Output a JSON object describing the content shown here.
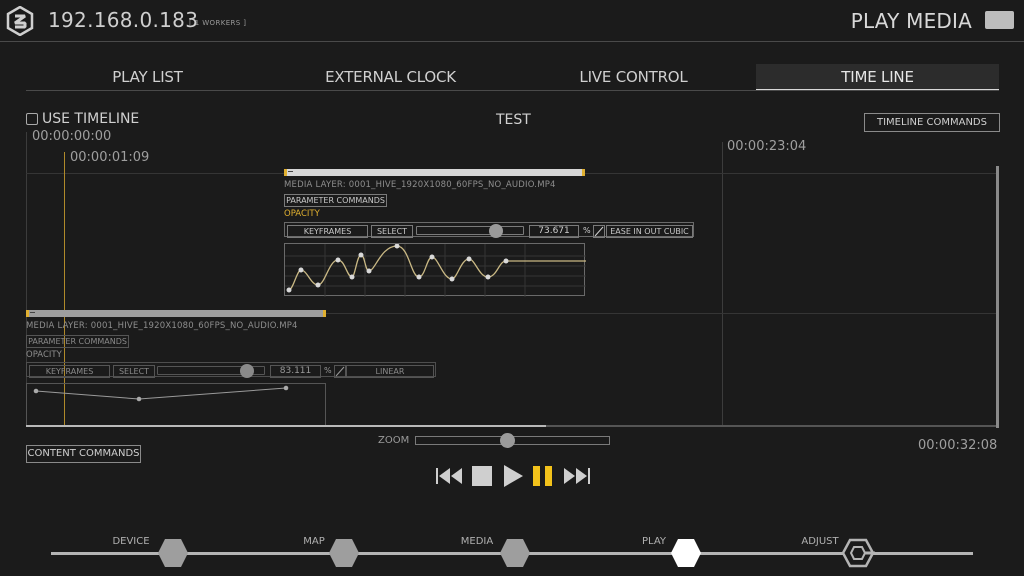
{
  "header": {
    "ip": "192.168.0.183",
    "workers": "[ 1 WORKERS ]",
    "page_title": "PLAY MEDIA"
  },
  "tabs": [
    {
      "label": "PLAY LIST",
      "active": false
    },
    {
      "label": "EXTERNAL CLOCK",
      "active": false
    },
    {
      "label": "LIVE CONTROL",
      "active": false
    },
    {
      "label": "TIME LINE",
      "active": true
    }
  ],
  "timeline": {
    "use_timeline_label": "USE TIMELINE",
    "use_timeline_checked": false,
    "name": "TEST",
    "commands_label": "TIMELINE COMMANDS",
    "time_start": "00:00:00:00",
    "time_cursor": "00:00:01:09",
    "time_mid": "00:00:23:04",
    "time_end": "00:00:32:08"
  },
  "layer_top": {
    "media_label": "MEDIA LAYER: 0001_HIVE_1920X1080_60FPS_NO_AUDIO.MP4",
    "param_commands": "PARAMETER COMMANDS",
    "opacity_label": "OPACITY",
    "keyframes": "KEYFRAMES",
    "select": "SELECT",
    "slider_fraction": 0.73671,
    "value": "73.671",
    "percent": "%",
    "easing": "EASE IN OUT CUBIC"
  },
  "layer_bottom": {
    "media_label": "MEDIA LAYER: 0001_HIVE_1920X1080_60FPS_NO_AUDIO.MP4",
    "param_commands": "PARAMETER COMMANDS",
    "opacity_label": "OPACITY",
    "keyframes": "KEYFRAMES",
    "select": "SELECT",
    "slider_fraction": 0.83111,
    "value": "83.111",
    "percent": "%",
    "easing": "LINEAR"
  },
  "controls": {
    "zoom_label": "ZOOM",
    "content_commands": "CONTENT COMMANDS"
  },
  "transport_icons": [
    "rewind-icon",
    "stop-icon",
    "play-icon",
    "pause-icon",
    "fast-forward-icon"
  ],
  "nav": [
    {
      "label": "DEVICE",
      "active": false
    },
    {
      "label": "MAP",
      "active": false
    },
    {
      "label": "MEDIA",
      "active": false
    },
    {
      "label": "PLAY",
      "active": true
    },
    {
      "label": "ADJUST",
      "active": false
    }
  ],
  "colors": {
    "background": "#1b1b1b",
    "accent": "#e0b030",
    "text": "#c8c8c8"
  }
}
